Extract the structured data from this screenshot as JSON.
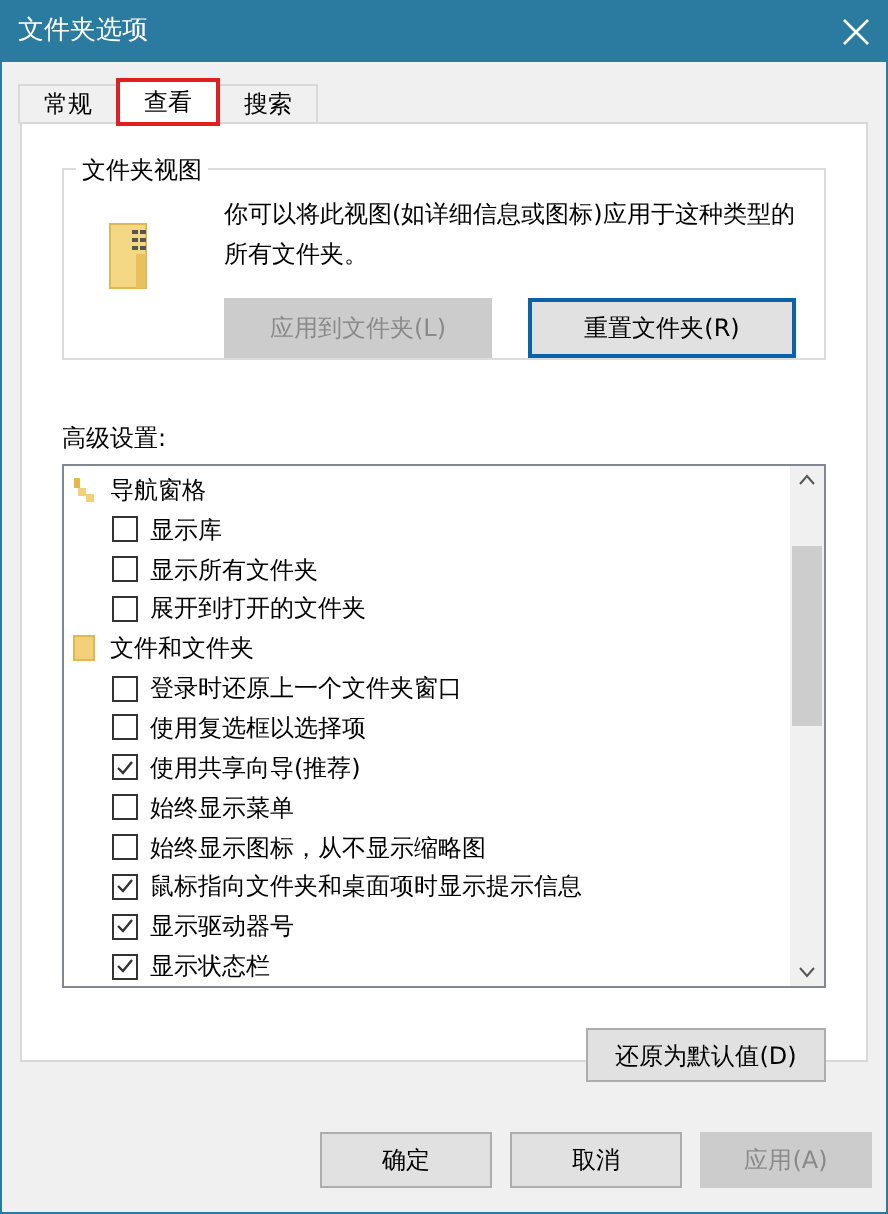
{
  "window": {
    "title": "文件夹选项"
  },
  "tabs": [
    {
      "label": "常规",
      "selected": false,
      "highlighted": false
    },
    {
      "label": "查看",
      "selected": true,
      "highlighted": true
    },
    {
      "label": "搜索",
      "selected": false,
      "highlighted": false
    }
  ],
  "folder_views": {
    "title": "文件夹视图",
    "description": "你可以将此视图(如详细信息或图标)应用于这种类型的所有文件夹。",
    "buttons": [
      {
        "label": "应用到文件夹(L)",
        "disabled": true,
        "focused": false
      },
      {
        "label": "重置文件夹(R)",
        "disabled": false,
        "focused": true
      }
    ]
  },
  "advanced": {
    "label": "高级设置:",
    "items": [
      {
        "label": "导航窗格",
        "kind": "nav-pane",
        "children": [
          {
            "label": "显示库",
            "checked": false
          },
          {
            "label": "显示所有文件夹",
            "checked": false
          },
          {
            "label": "展开到打开的文件夹",
            "checked": false
          }
        ]
      },
      {
        "label": "文件和文件夹",
        "kind": "folder",
        "children": [
          {
            "label": "登录时还原上一个文件夹窗口",
            "checked": false
          },
          {
            "label": "使用复选框以选择项",
            "checked": false
          },
          {
            "label": "使用共享向导(推荐)",
            "checked": true
          },
          {
            "label": "始终显示菜单",
            "checked": false
          },
          {
            "label": "始终显示图标，从不显示缩略图",
            "checked": false
          },
          {
            "label": "鼠标指向文件夹和桌面项时显示提示信息",
            "checked": true
          },
          {
            "label": "显示驱动器号",
            "checked": true
          },
          {
            "label": "显示状态栏",
            "checked": true
          }
        ]
      }
    ]
  },
  "restore_button": {
    "label": "还原为默认值(D)"
  },
  "buttons": [
    {
      "label": "确定",
      "disabled": false
    },
    {
      "label": "取消",
      "disabled": false
    },
    {
      "label": "应用(A)",
      "disabled": true
    }
  ]
}
